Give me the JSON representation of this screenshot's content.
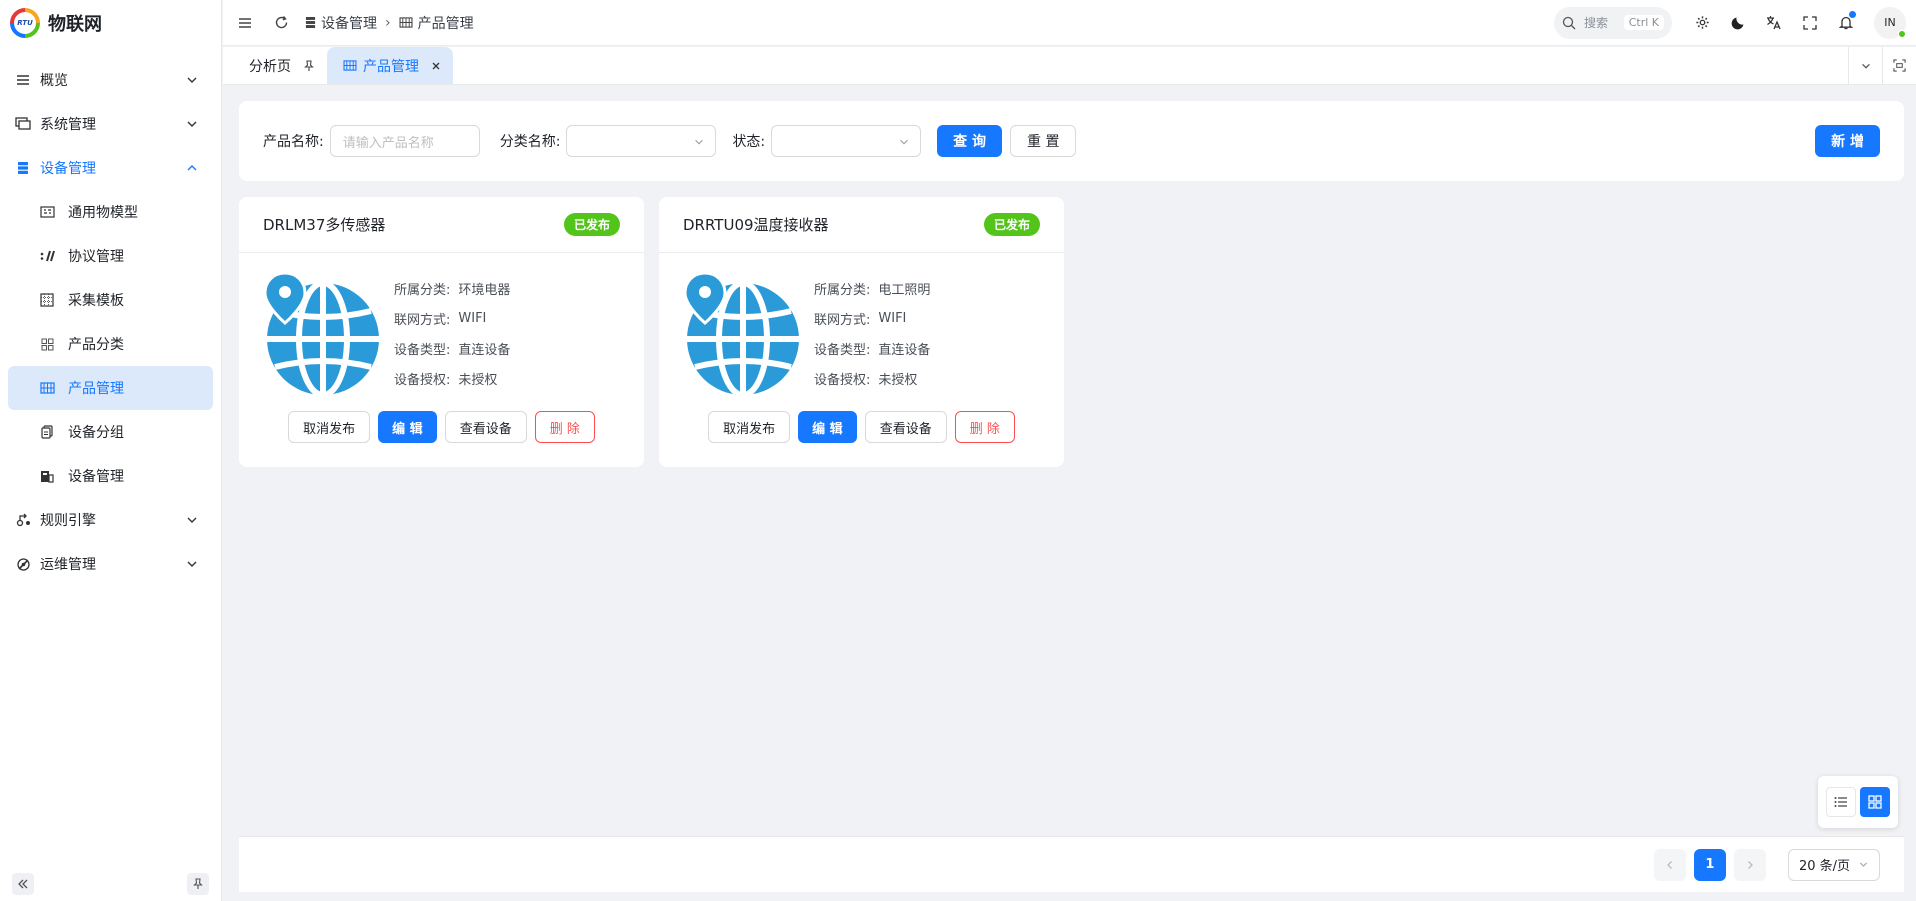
{
  "app": {
    "logo_mark": "RTU",
    "title": "物联网"
  },
  "sidebar": {
    "items": [
      {
        "label": "概览",
        "icon": "menu-lines-icon",
        "expandable": true
      },
      {
        "label": "系统管理",
        "icon": "monitor-icon",
        "expandable": true
      },
      {
        "label": "设备管理",
        "icon": "server-icon",
        "expandable": true,
        "open": true,
        "children": [
          {
            "label": "通用物模型",
            "icon": "model-icon"
          },
          {
            "label": "协议管理",
            "icon": "protocol-icon"
          },
          {
            "label": "采集模板",
            "icon": "grid-template-icon"
          },
          {
            "label": "产品分类",
            "icon": "category-icon"
          },
          {
            "label": "产品管理",
            "icon": "product-icon",
            "active": true
          },
          {
            "label": "设备分组",
            "icon": "group-icon"
          },
          {
            "label": "设备管理",
            "icon": "device-icon"
          }
        ]
      },
      {
        "label": "规则引擎",
        "icon": "rule-icon",
        "expandable": true
      },
      {
        "label": "运维管理",
        "icon": "ops-icon",
        "expandable": true
      }
    ]
  },
  "header": {
    "breadcrumb": [
      "设备管理",
      "产品管理"
    ],
    "search_placeholder": "搜索",
    "search_shortcut": "Ctrl K",
    "avatar_text": "IN"
  },
  "tabs": [
    {
      "label": "分析页",
      "pinned": true
    },
    {
      "label": "产品管理",
      "active": true
    }
  ],
  "filter": {
    "product_name_label": "产品名称:",
    "product_name_placeholder": "请输入产品名称",
    "category_label": "分类名称:",
    "status_label": "状态:",
    "query_button": "查 询",
    "reset_button": "重 置",
    "add_button": "新 增"
  },
  "products": [
    {
      "name": "DRLM37多传感器",
      "status": "已发布",
      "category_label": "所属分类:",
      "category": "环境电器",
      "network_label": "联网方式:",
      "network": "WIFI",
      "device_type_label": "设备类型:",
      "device_type": "直连设备",
      "auth_label": "设备授权:",
      "auth": "未授权",
      "actions": {
        "unpublish": "取消发布",
        "edit": "编 辑",
        "view_devices": "查看设备",
        "delete": "删 除"
      }
    },
    {
      "name": "DRRTU09温度接收器",
      "status": "已发布",
      "category_label": "所属分类:",
      "category": "电工照明",
      "network_label": "联网方式:",
      "network": "WIFI",
      "device_type_label": "设备类型:",
      "device_type": "直连设备",
      "auth_label": "设备授权:",
      "auth": "未授权",
      "actions": {
        "unpublish": "取消发布",
        "edit": "编 辑",
        "view_devices": "查看设备",
        "delete": "删 除"
      }
    }
  ],
  "pagination": {
    "current_page": "1",
    "page_size": "20 条/页"
  },
  "colors": {
    "primary": "#1677ff",
    "success": "#52c41a",
    "danger": "#ff4d4f",
    "globe": "#2a9bd8"
  }
}
